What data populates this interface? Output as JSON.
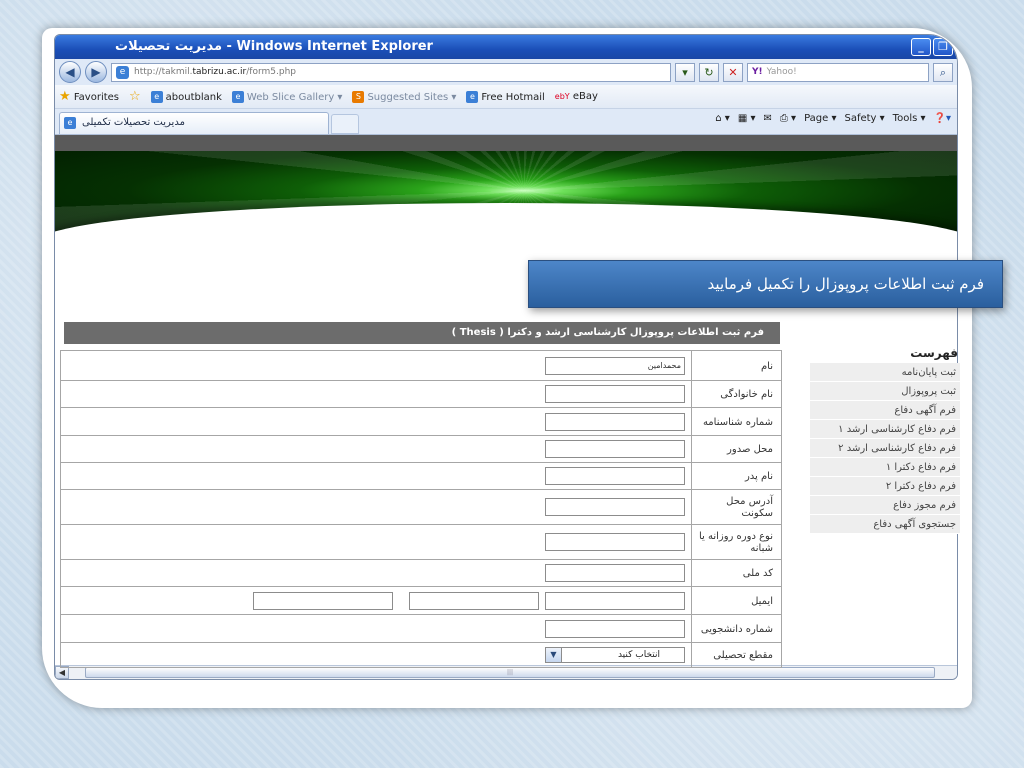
{
  "window": {
    "title": "مدیریت تحصیلات - Windows Internet Explorer",
    "controls": [
      "_",
      "❐"
    ]
  },
  "address": {
    "url_prefix": "http://takmil.",
    "url_domain": "tabrizu.ac.ir",
    "url_suffix": "/form5.php",
    "search_brand": "Y!",
    "search_placeholder": "Yahoo!"
  },
  "favorites": {
    "label": "Favorites",
    "items": [
      {
        "label": "aboutblank",
        "muted": false
      },
      {
        "label": "Web Slice Gallery ▾",
        "muted": true
      },
      {
        "label": "Suggested Sites ▾",
        "muted": true
      },
      {
        "label": "Free Hotmail",
        "muted": false
      },
      {
        "label": "eBay",
        "muted": false
      }
    ]
  },
  "tabs": {
    "active_label": "مدیریت تحصیلات تکمیلی",
    "commands": [
      "Page ▾",
      "Safety ▾",
      "Tools ▾"
    ]
  },
  "popup_title": "فرم ثبت اطلاعات پروپوزال را تکمیل فرمایید",
  "form": {
    "header": "فرم ثبت اطلاعات پروپوزال کارشناسی ارشد و دکترا ( Thesis )",
    "rows": [
      {
        "label": "نام",
        "value": "محمدامین"
      },
      {
        "label": "نام خانوادگی",
        "value": ""
      },
      {
        "label": "شماره شناسنامه",
        "value": ""
      },
      {
        "label": "محل صدور",
        "value": ""
      },
      {
        "label": "نام پدر",
        "value": ""
      },
      {
        "label": "آدرس محل سکونت",
        "value": ""
      },
      {
        "label": "نوع دوره روزانه یا شبانه",
        "value": ""
      },
      {
        "label": "کد ملی",
        "value": ""
      },
      {
        "label": "ایمیل",
        "value": ""
      },
      {
        "label": "شماره دانشجویی",
        "value": ""
      },
      {
        "label": "مقطع تحصیلی",
        "select_value": "انتخاب کنید"
      }
    ]
  },
  "sidebar": {
    "title": "فهرست",
    "items": [
      "ثبت پایان‌نامه",
      "ثبت پروپوزال",
      "فرم آگهی دفاع",
      "فرم دفاع کارشناسی ارشد ۱",
      "فرم دفاع کارشناسی ارشد ۲",
      "فرم دفاع دکترا ۱",
      "فرم دفاع دکترا ۲",
      "فرم مجوز دفاع",
      "جستجوی آگهی دفاع"
    ]
  }
}
